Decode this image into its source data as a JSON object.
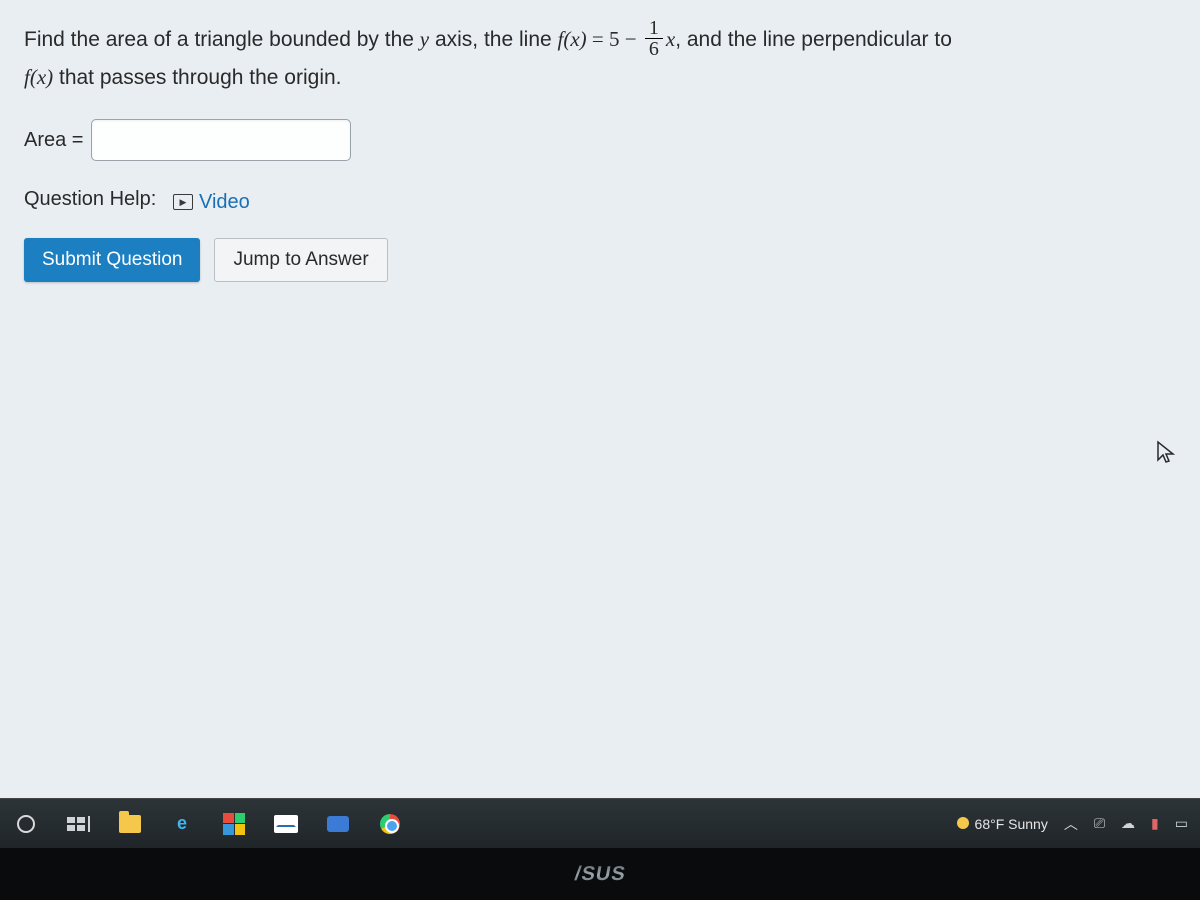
{
  "question": {
    "part1": "Find the area of a triangle bounded by the ",
    "yaxis": "y",
    "part2": " axis, the line ",
    "fx": "f(x)",
    "eq": " = ",
    "five": "5",
    "minus": " − ",
    "frac_num": "1",
    "frac_den": "6",
    "xvar": "x",
    "comma": ", ",
    "part3": "and the line perpendicular to ",
    "fx2": "f(x)",
    "part4": " that passes through the origin."
  },
  "answer": {
    "label": "Area =",
    "value": ""
  },
  "help": {
    "label": "Question Help:",
    "video": "Video"
  },
  "buttons": {
    "submit": "Submit Question",
    "jump": "Jump to Answer"
  },
  "taskbar": {
    "weather": "68°F Sunny"
  },
  "bezel": {
    "brand": "/SUS"
  }
}
